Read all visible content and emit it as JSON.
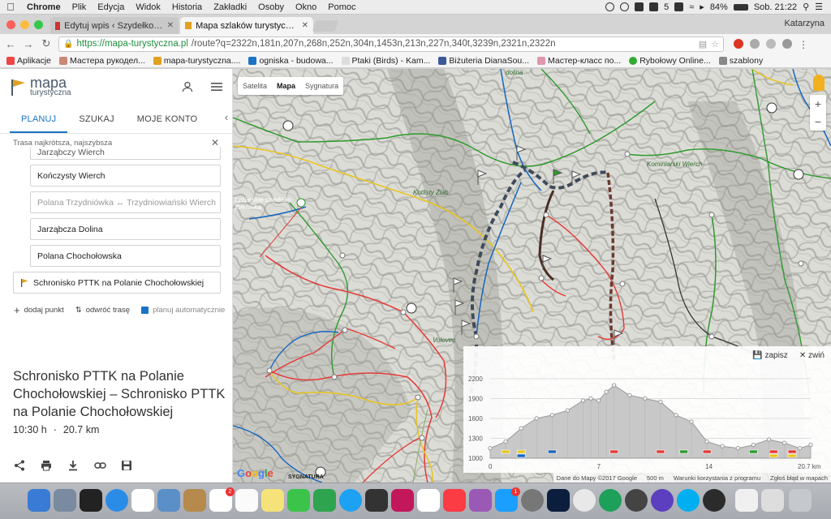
{
  "menubar": {
    "items": [
      "Chrome",
      "Plik",
      "Edycja",
      "Widok",
      "Historia",
      "Zakładki",
      "Osoby",
      "Okno",
      "Pomoc"
    ],
    "battery": "84%",
    "clock": "Sob. 21:22",
    "badge_count": "5"
  },
  "browser": {
    "tabs": [
      {
        "label": "Edytuj wpis ‹ Szydełko w górach"
      },
      {
        "label": "Mapa szlaków turystycznych"
      }
    ],
    "user": "Katarzyna",
    "url_host": "https://mapa-turystyczna.pl",
    "url_path": "/route?q=2322n,181n,207n,268n,252n,304n,1453n,213n,227n,340t,3239n,2321n,2322n",
    "bookmarks": [
      "Aplikacje",
      "Мастера рукодел...",
      "mapa-turystyczna....",
      "ogniska - budowa...",
      "Ptaki (Birds) - Kam...",
      "Biżuteria DianaSou...",
      "Мастер-класс по...",
      "Rybołowy Online...",
      "szablony"
    ]
  },
  "sidebar": {
    "logo_line1": "mapa",
    "logo_line2": "turystyczna",
    "tabs": [
      "PLANUJ",
      "SZUKAJ",
      "MOJE KONTO"
    ],
    "mode": "Trasa najkrótsza, najszybsza",
    "waypoints": [
      {
        "label": "Jarząbczy Wierch",
        "state": "partial"
      },
      {
        "label": "Kończysty Wierch",
        "state": "normal"
      },
      {
        "label": "Polana Trzydniówka ↔ Trzydniowiański Wierch",
        "state": "grey"
      },
      {
        "label": "Jarząbcza Dolina",
        "state": "normal"
      },
      {
        "label": "Polana Chochołowska",
        "state": "normal"
      }
    ],
    "destination": "Schronisko PTTK na Polanie Chochołowskiej",
    "actions": {
      "add": "dodaj punkt",
      "reverse": "odwróć trasę",
      "auto": "planuj automatycznie"
    },
    "route_title": "Schronisko PTTK na Polanie Chochołowskiej – Schronisko PTTK na Polanie Chochołowskiej",
    "duration": "10:30 h",
    "distance": "20.7 km"
  },
  "map": {
    "map_types": [
      "Satelita",
      "Mapa",
      "Sygnatura"
    ],
    "selected_type": "Mapa",
    "labels": [
      "Kominiarski Wierch",
      "Kotlisty Żlab",
      "Volovec",
      "Łyżiarskie stredisko Zverovka",
      "dolina"
    ],
    "google": "Google",
    "sygnatura": "SYGNATURA",
    "attribution": [
      "Dane do Mapy ©2017 Google",
      "500 m",
      "Warunki korzystania z programu",
      "Zgłoś błąd w mapach"
    ]
  },
  "elevation": {
    "save_label": "zapisz",
    "collapse_label": "zwiń",
    "y_ticks": [
      "2200",
      "1900",
      "1600",
      "1300",
      "1000"
    ],
    "x_ticks": [
      "0",
      "7",
      "14",
      "20.7 km"
    ],
    "profile": {
      "x_km": [
        0,
        1,
        2,
        3,
        4,
        5,
        6,
        6.5,
        7,
        7.5,
        8,
        9,
        10,
        11,
        12,
        13,
        14,
        15,
        16,
        17,
        18,
        19,
        20,
        20.7
      ],
      "y_m": [
        1150,
        1250,
        1450,
        1600,
        1650,
        1720,
        1870,
        1900,
        1870,
        2000,
        2100,
        1950,
        1900,
        1850,
        1650,
        1550,
        1250,
        1180,
        1150,
        1200,
        1280,
        1230,
        1150,
        1200
      ]
    }
  },
  "colors": {
    "accent": "#1a73c6",
    "route": "#444444",
    "trail_red": "#e53935",
    "trail_blue": "#1565c0",
    "trail_green": "#2e9a2e",
    "trail_yellow": "#e8c51c"
  }
}
